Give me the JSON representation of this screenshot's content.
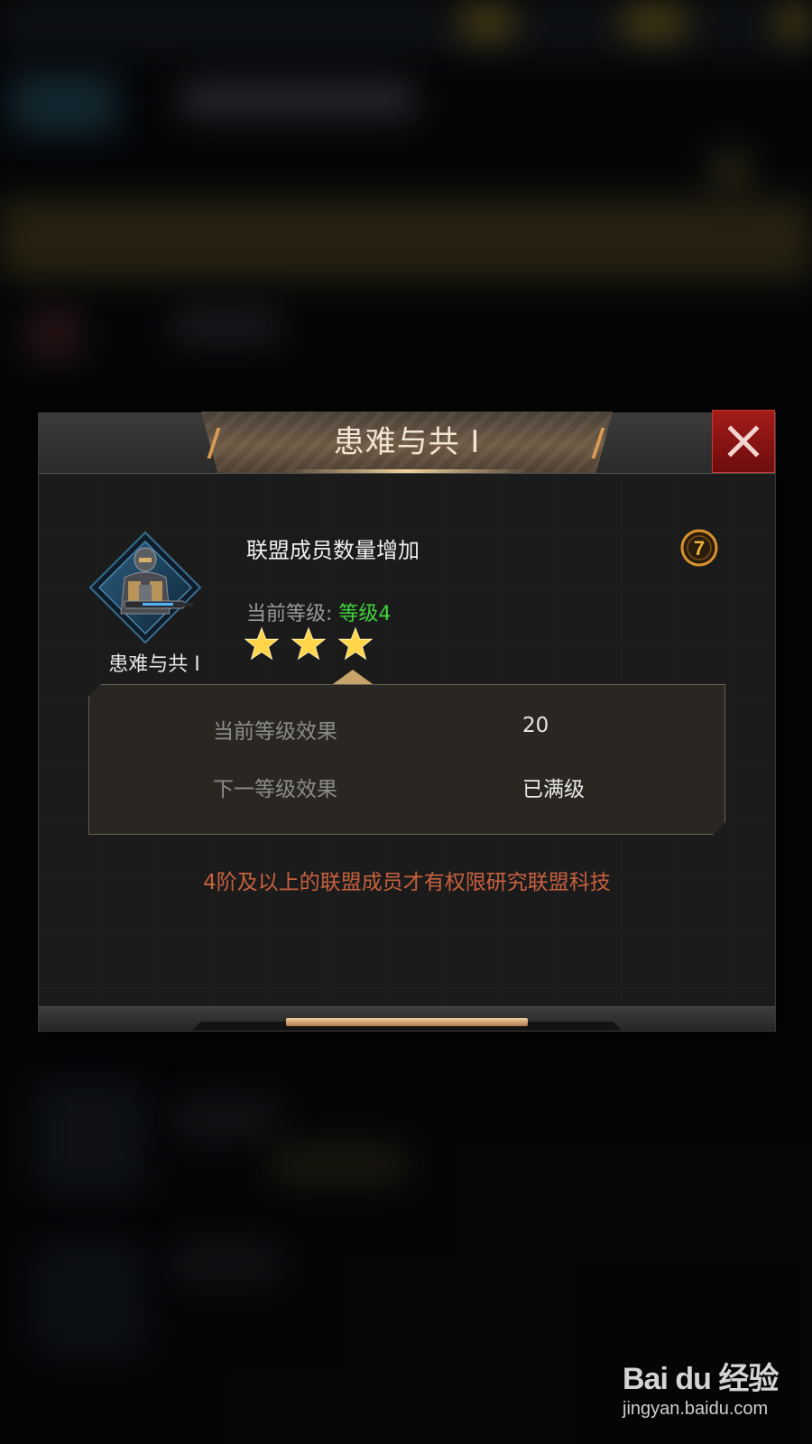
{
  "modal": {
    "title": "患难与共 I",
    "emblem_label": "患难与共 I",
    "tech_name": "联盟成员数量增加",
    "help_icon": "question-icon",
    "current_level_label": "当前等级:",
    "current_level_value": "等级4",
    "stars_filled": 3,
    "stars_total": 3,
    "effects": [
      {
        "label": "当前等级效果",
        "value": "20"
      },
      {
        "label": "下一等级效果",
        "value": "已满级"
      }
    ],
    "notice": "4阶及以上的联盟成员才有权限研究联盟科技",
    "close_icon": "close-icon"
  },
  "colors": {
    "level_value": "#3fd23c",
    "notice": "#c8613e",
    "close_button": "#a31c1a",
    "star": "#ffd54a"
  },
  "watermark": {
    "logo": "Bai du 经验",
    "url": "jingyan.baidu.com"
  }
}
